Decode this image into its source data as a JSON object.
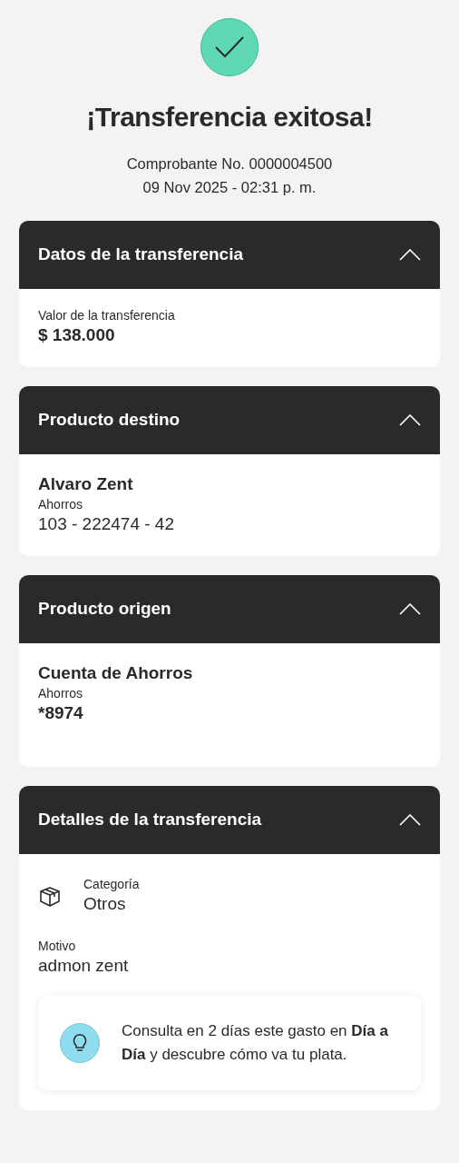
{
  "status": {
    "title": "¡Transferencia exitosa!",
    "receipt": "Comprobante No. 0000004500",
    "datetime": "09 Nov 2025 - 02:31 p. m."
  },
  "sections": [
    {
      "header": "Datos de la transferencia",
      "expanded": true,
      "items": [
        {
          "kind": "label",
          "text": "Valor de la transferencia"
        },
        {
          "kind": "amount",
          "text": "$ 138.000"
        }
      ]
    },
    {
      "header": "Producto destino",
      "expanded": true,
      "items": [
        {
          "kind": "name",
          "text": "Alvaro Zent"
        },
        {
          "kind": "label",
          "text": "Ahorros"
        },
        {
          "kind": "account",
          "text": "103 - 222474 - 42"
        }
      ]
    },
    {
      "header": "Producto origen",
      "expanded": true,
      "items": [
        {
          "kind": "name",
          "text": "Cuenta de Ahorros"
        },
        {
          "kind": "label",
          "text": "Ahorros"
        },
        {
          "kind": "amount",
          "text": "*8974"
        }
      ]
    },
    {
      "header": "Detalles de la transferencia",
      "expanded": true,
      "items": [
        {
          "kind": "category",
          "label": "Categoría",
          "text": "Otros"
        },
        {
          "kind": "field",
          "label": "Motivo",
          "text": "admon zent"
        },
        {
          "kind": "tip",
          "text": "Consulta en 2 días este gasto en **Día a Día** y descubre cómo va tu plata."
        }
      ]
    }
  ]
}
